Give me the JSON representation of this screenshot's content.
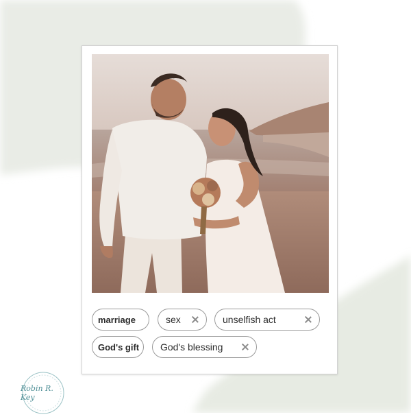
{
  "tags": [
    {
      "label": "marriage",
      "bold": true,
      "removable": false
    },
    {
      "label": "sex",
      "bold": false,
      "removable": true
    },
    {
      "label": "unselfish act",
      "bold": false,
      "removable": true
    },
    {
      "label": "God's gift",
      "bold": true,
      "removable": false
    },
    {
      "label": "God's blessing",
      "bold": false,
      "removable": true
    }
  ],
  "logo": {
    "text": "Robin R. Key",
    "color": "#4f8f96"
  },
  "colors": {
    "tag_border": "#9a9a9a",
    "card_border": "#d2d2d2",
    "wash": "#e9ece6"
  }
}
